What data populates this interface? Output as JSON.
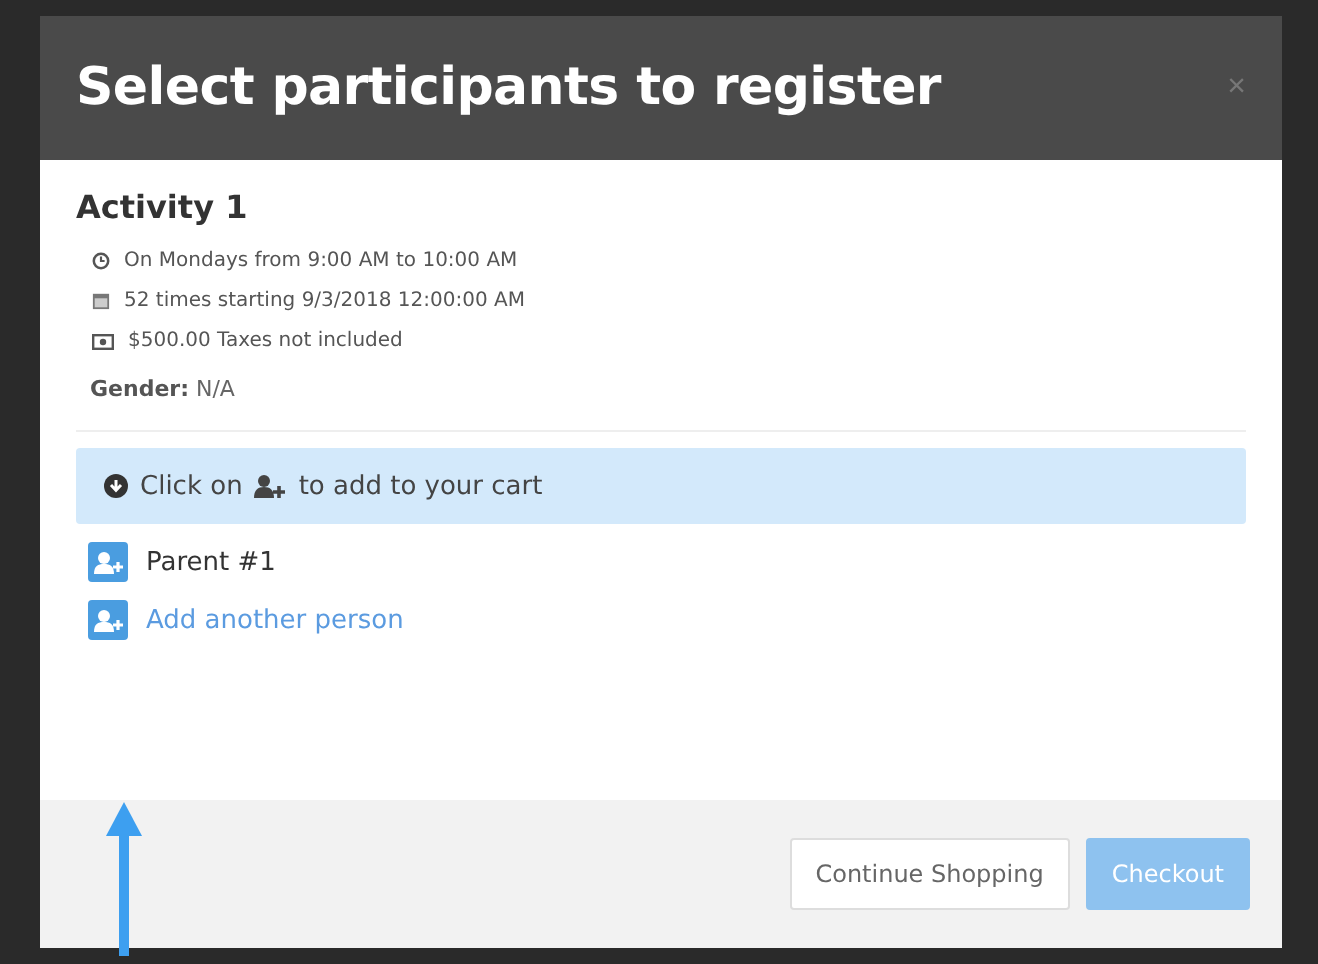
{
  "dialog": {
    "title": "Select participants to register",
    "close": "×"
  },
  "activity": {
    "name": "Activity 1",
    "details": [
      {
        "kind": "clock",
        "text": "On Mondays from 9:00 AM to 10:00 AM"
      },
      {
        "kind": "calendar",
        "text": "52 times starting 9/3/2018 12:00:00 AM"
      },
      {
        "kind": "money",
        "text": "$500.00 Taxes not included"
      }
    ],
    "gender": {
      "label": "Gender:",
      "value": "N/A"
    }
  },
  "hint": {
    "before": "Click on",
    "after": "to add to your cart"
  },
  "people": [
    {
      "kind": "participant",
      "label": "Parent #1"
    },
    {
      "kind": "add",
      "label": "Add another person"
    }
  ],
  "buttons": [
    {
      "label": "Continue Shopping",
      "kind": "secondary",
      "disabled": false
    },
    {
      "label": "Checkout",
      "kind": "primary",
      "disabled": true
    }
  ]
}
